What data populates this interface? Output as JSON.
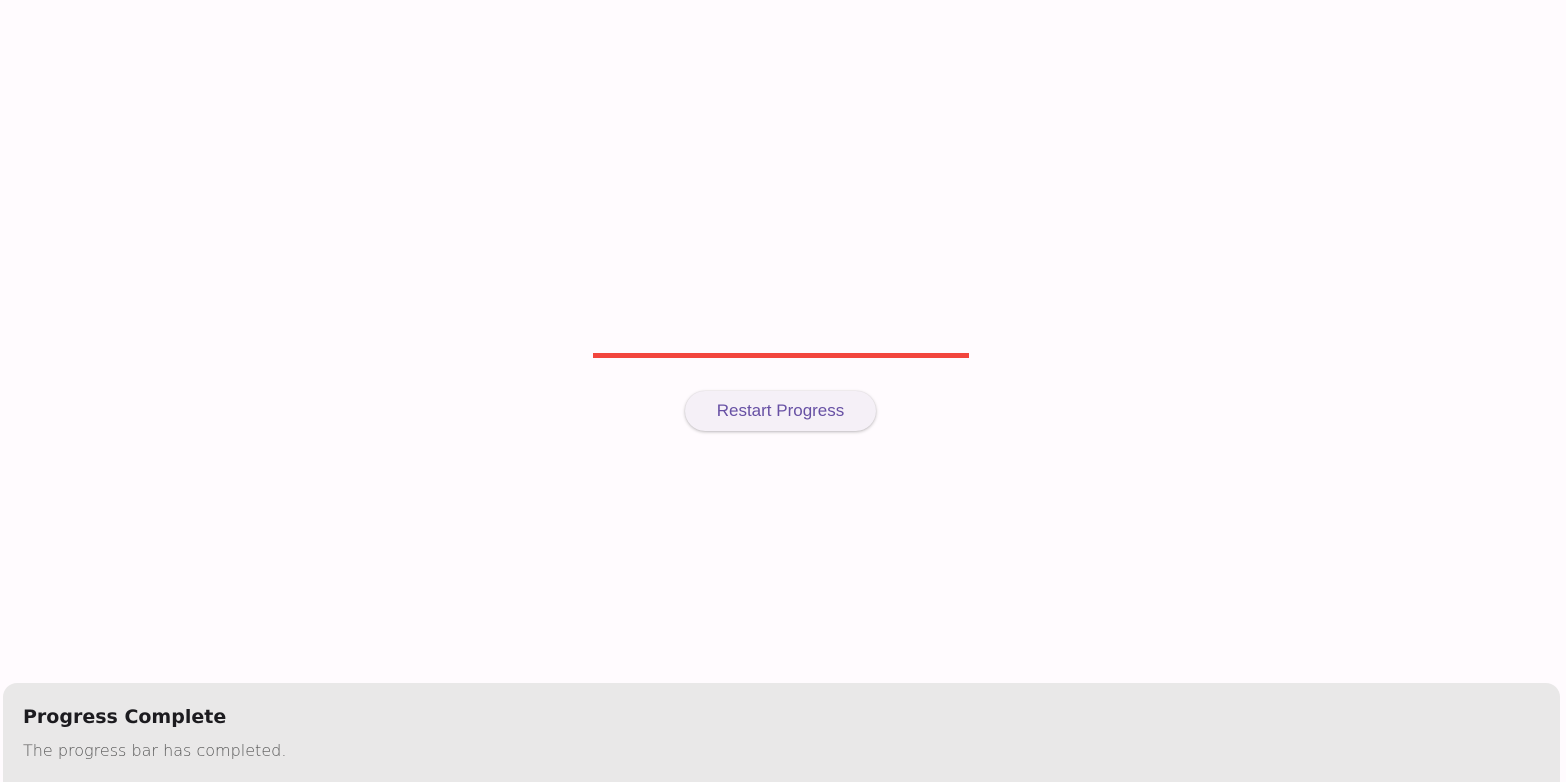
{
  "progress": {
    "value": 1.0,
    "color": "#f2453d"
  },
  "restart_button": {
    "label": "Restart Progress"
  },
  "notification": {
    "title": "Progress Complete",
    "message": "The progress bar has completed."
  }
}
